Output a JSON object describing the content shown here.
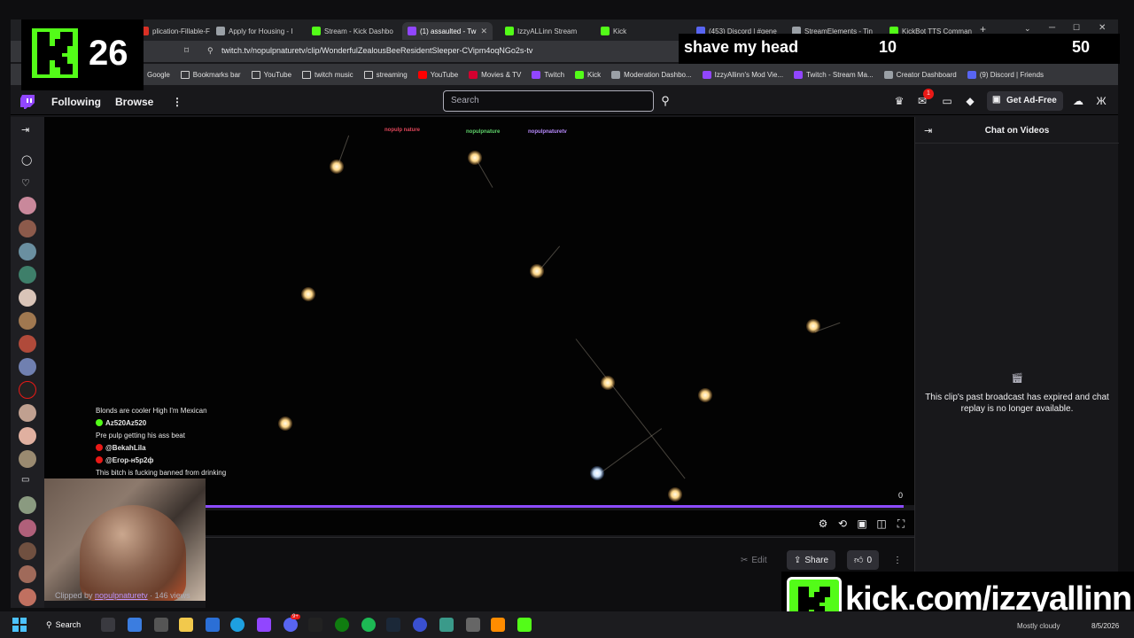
{
  "browser": {
    "tabs": [
      {
        "label": "plication-Fillable-F",
        "fav_color": "#d93025"
      },
      {
        "label": "Apply for Housing - I",
        "fav_color": "#9aa0a6"
      },
      {
        "label": "Stream - Kick Dashbo",
        "fav_color": "#53fc18"
      },
      {
        "label": "(1) assaulted - Tw",
        "fav_color": "#9146ff",
        "active": true
      },
      {
        "label": "IzzyALLinn Stream",
        "fav_color": "#53fc18"
      },
      {
        "label": "Kick",
        "fav_color": "#53fc18"
      },
      {
        "label": "(453) Discord | #gene",
        "fav_color": "#5865f2"
      },
      {
        "label": "StreamElements - Tin",
        "fav_color": "#9aa0a6"
      },
      {
        "label": "KickBot TTS Comman",
        "fav_color": "#53fc18"
      }
    ],
    "url": "twitch.tv/nopulpnaturetv/clip/WonderfulZealousBeeResidentSleeper-CVipm4oqNGo2s-tv",
    "bookmarks": [
      {
        "label": "Google",
        "icon_color": "#4285f4"
      },
      {
        "label": "Bookmarks bar",
        "icon_color": ""
      },
      {
        "label": "YouTube",
        "icon_color": ""
      },
      {
        "label": "twitch music",
        "icon_color": ""
      },
      {
        "label": "streaming",
        "icon_color": ""
      },
      {
        "label": "YouTube",
        "icon_color": "#ff0000"
      },
      {
        "label": "Movies & TV",
        "icon_color": "#d3002f"
      },
      {
        "label": "Twitch",
        "icon_color": "#9146ff"
      },
      {
        "label": "Kick",
        "icon_color": "#53fc18"
      },
      {
        "label": "Moderation Dashbo...",
        "icon_color": "#9aa0a6"
      },
      {
        "label": "IzzyAllinn's Mod Vie...",
        "icon_color": "#9146ff"
      },
      {
        "label": "Twitch - Stream Ma...",
        "icon_color": "#9146ff"
      },
      {
        "label": "Creator Dashboard",
        "icon_color": "#9aa0a6"
      },
      {
        "label": "(9) Discord | Friends",
        "icon_color": "#5865f2"
      }
    ]
  },
  "twitch": {
    "nav": {
      "following": "Following",
      "browse": "Browse",
      "search_placeholder": "Search",
      "notification_count": "1",
      "get_ad_free": "Get Ad-Free"
    },
    "video": {
      "watermarks": [
        "nopulp nature",
        "nopulpnature",
        "nopulpnaturetv"
      ],
      "progress_fraction": 0.0,
      "time_value": "0",
      "chat_overlay": [
        {
          "user": "",
          "text": "Blonds are cooler High I'm Mexican",
          "badge_color": ""
        },
        {
          "user": "Az520Az520",
          "text": "",
          "badge_color": "#53fc18"
        },
        {
          "user": "",
          "text": "Pre pulp getting his ass beat",
          "badge_color": ""
        },
        {
          "user": "@BekahLila",
          "text": "",
          "badge_color": "#e91916"
        },
        {
          "user": "@Егор-н5р2ф",
          "text": "",
          "badge_color": "#e91916"
        },
        {
          "user": "",
          "text": "This bitch is fucking banned from drinking",
          "badge_color": ""
        }
      ]
    },
    "actions": {
      "edit": "Edit",
      "share": "Share",
      "like_count": "0"
    },
    "clip_info": {
      "prefix": "Clipped by",
      "clipper": "nopulpnaturetv",
      "views": "· 146 views"
    },
    "chat_panel": {
      "title": "Chat on Videos",
      "message": "This clip's past broadcast has expired and chat replay is no longer available."
    }
  },
  "overlay": {
    "kick_count": "26",
    "goal_text": "shave my head",
    "goal_current": "10",
    "goal_target": "50",
    "kick_url": "kick.com/izzyallinn",
    "accent_color": "#53fc18"
  },
  "taskbar": {
    "search_label": "Search",
    "discord_badge": "9+",
    "weather": "Mostly cloudy",
    "date": "8/5/2026"
  }
}
